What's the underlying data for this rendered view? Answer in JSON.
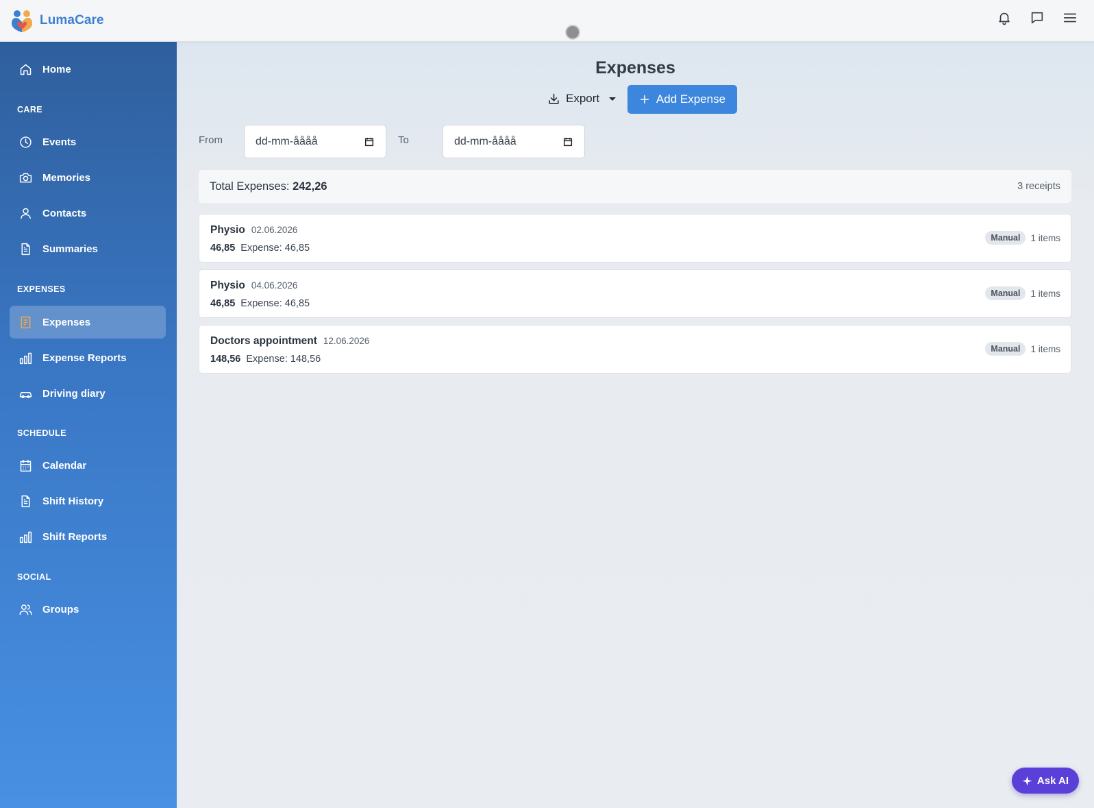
{
  "app": {
    "name": "LumaCare"
  },
  "sidebar": {
    "home": "Home",
    "sections": {
      "care": "CARE",
      "expenses": "EXPENSES",
      "schedule": "SCHEDULE",
      "social": "SOCIAL"
    },
    "items": {
      "events": "Events",
      "memories": "Memories",
      "contacts": "Contacts",
      "summaries": "Summaries",
      "expenses": "Expenses",
      "expense_reports": "Expense Reports",
      "driving_diary": "Driving diary",
      "calendar": "Calendar",
      "shift_history": "Shift History",
      "shift_reports": "Shift Reports",
      "groups": "Groups"
    },
    "active_item": "Expenses"
  },
  "page": {
    "title": "Expenses",
    "export_label": "Export",
    "add_label": "Add Expense",
    "filters": {
      "from_label": "From",
      "to_label": "To",
      "from_value": "dd-mm-åååå",
      "to_value": "dd-mm-åååå"
    },
    "summary": {
      "label": "Total Expenses:",
      "total": "242,26",
      "receipts": "3 receipts"
    },
    "expenses": [
      {
        "title": "Physio",
        "date": "02.06.2026",
        "amount": "46,85",
        "expense": "Expense: 46,85",
        "badge": "Manual",
        "items": "1 items"
      },
      {
        "title": "Physio",
        "date": "04.06.2026",
        "amount": "46,85",
        "expense": "Expense: 46,85",
        "badge": "Manual",
        "items": "1 items"
      },
      {
        "title": "Doctors appointment",
        "date": "12.06.2026",
        "amount": "148,56",
        "expense": "Expense: 148,56",
        "badge": "Manual",
        "items": "1 items"
      }
    ]
  },
  "ask_ai": "Ask AI",
  "icons": {
    "topbar": [
      "bell-icon",
      "chat-icon",
      "menu-icon"
    ],
    "accent": "#3d86dd",
    "active_icon_color": "#f3a94a",
    "ask_ai_color": "#5a3fd8"
  }
}
